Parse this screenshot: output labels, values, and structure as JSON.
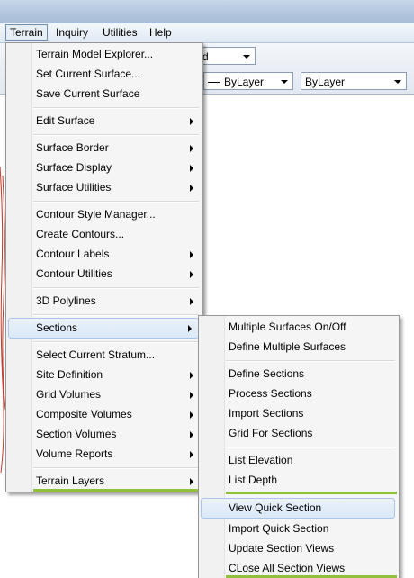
{
  "menubar": {
    "items": [
      {
        "label": "Terrain"
      },
      {
        "label": "Inquiry"
      },
      {
        "label": "Utilities"
      },
      {
        "label": "Help"
      }
    ]
  },
  "toolbar": {
    "combo1_value": "d",
    "linetype_value": "ByLayer",
    "lineweight_value": "ByLayer"
  },
  "terrain_menu": {
    "items": [
      "Terrain Model Explorer...",
      "Set Current Surface...",
      "Save Current Surface",
      "Edit Surface",
      "Surface Border",
      "Surface Display",
      "Surface Utilities",
      "Contour Style Manager...",
      "Create Contours...",
      "Contour Labels",
      "Contour Utilities",
      "3D Polylines",
      "Sections",
      "Select Current Stratum...",
      "Site Definition",
      "Grid Volumes",
      "Composite Volumes",
      "Section Volumes",
      "Volume Reports",
      "Terrain Layers"
    ]
  },
  "sections_menu": {
    "items": [
      "Multiple Surfaces On/Off",
      "Define Multiple Surfaces",
      "Define Sections",
      "Process Sections",
      "Import Sections",
      "Grid For Sections",
      "List Elevation",
      "List Depth",
      "View Quick Section",
      "Import Quick Section",
      "Update Section Views",
      "CLose All Section Views"
    ]
  },
  "colors": {
    "accent_green": "#8fc23a",
    "hover_border": "#a8c6ec",
    "drawing_red": "#c0392b"
  }
}
